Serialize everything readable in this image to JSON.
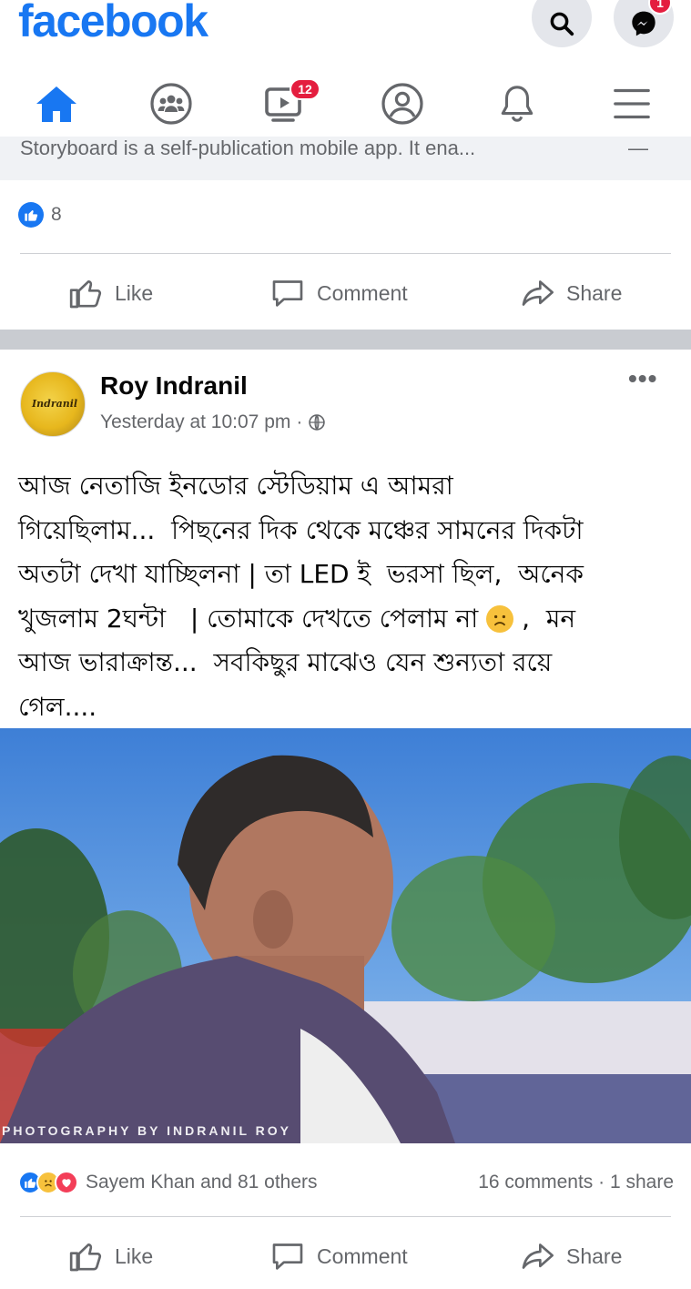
{
  "header": {
    "logo": "facebook",
    "messenger_badge": "1"
  },
  "tabs": {
    "items": [
      {
        "name": "home",
        "icon": "home-icon",
        "active": true
      },
      {
        "name": "groups",
        "icon": "groups-icon"
      },
      {
        "name": "watch",
        "icon": "video-icon",
        "badge": "12"
      },
      {
        "name": "profile",
        "icon": "profile-icon"
      },
      {
        "name": "notifications",
        "icon": "bell-icon"
      },
      {
        "name": "menu",
        "icon": "hamburger-icon"
      }
    ],
    "accent": "#1877f2"
  },
  "prev_post": {
    "snippet": "Storyboard is a self-publication mobile app. It ena...",
    "like_count": "8",
    "actions": {
      "like": "Like",
      "comment": "Comment",
      "share": "Share"
    }
  },
  "post": {
    "author": "Roy Indranil",
    "timestamp": "Yesterday at 10:07 pm",
    "meta_sep": "·",
    "text_lines": [
      "আজ নেতাজি ইনডোর স্টেডিয়াম এ আমরা",
      "গিয়েছিলাম...  পিছনের দিক থেকে মঞ্চের সামনের দিকটা",
      "অতটা দেখা যাচ্ছিলনা | তা LED ই  ভরসা ছিল,  অনেক",
      "খুজলাম 2ঘন্টা   | তোমাকে দেখতে পেলাম না ",
      "আজ ভারাক্রান্ত...  সবকিছুর মাঝেও যেন শুন্যতা রয়ে",
      "গেল...."
    ],
    "line4_tail": " ,  মন",
    "photo_credit": "PHOTOGRAPHY BY INDRANIL ROY",
    "reactions": {
      "names": "Sayem Khan and 81 others",
      "counts": "16 comments · 1 share",
      "icons": [
        "like-reaction-icon",
        "sad-reaction-icon",
        "love-reaction-icon"
      ]
    },
    "actions": {
      "like": "Like",
      "comment": "Comment",
      "share": "Share"
    }
  },
  "colors": {
    "brand": "#1877f2",
    "badge": "#e41e3f",
    "secondary_text": "#65676b",
    "separator": "#c9ccd1"
  }
}
